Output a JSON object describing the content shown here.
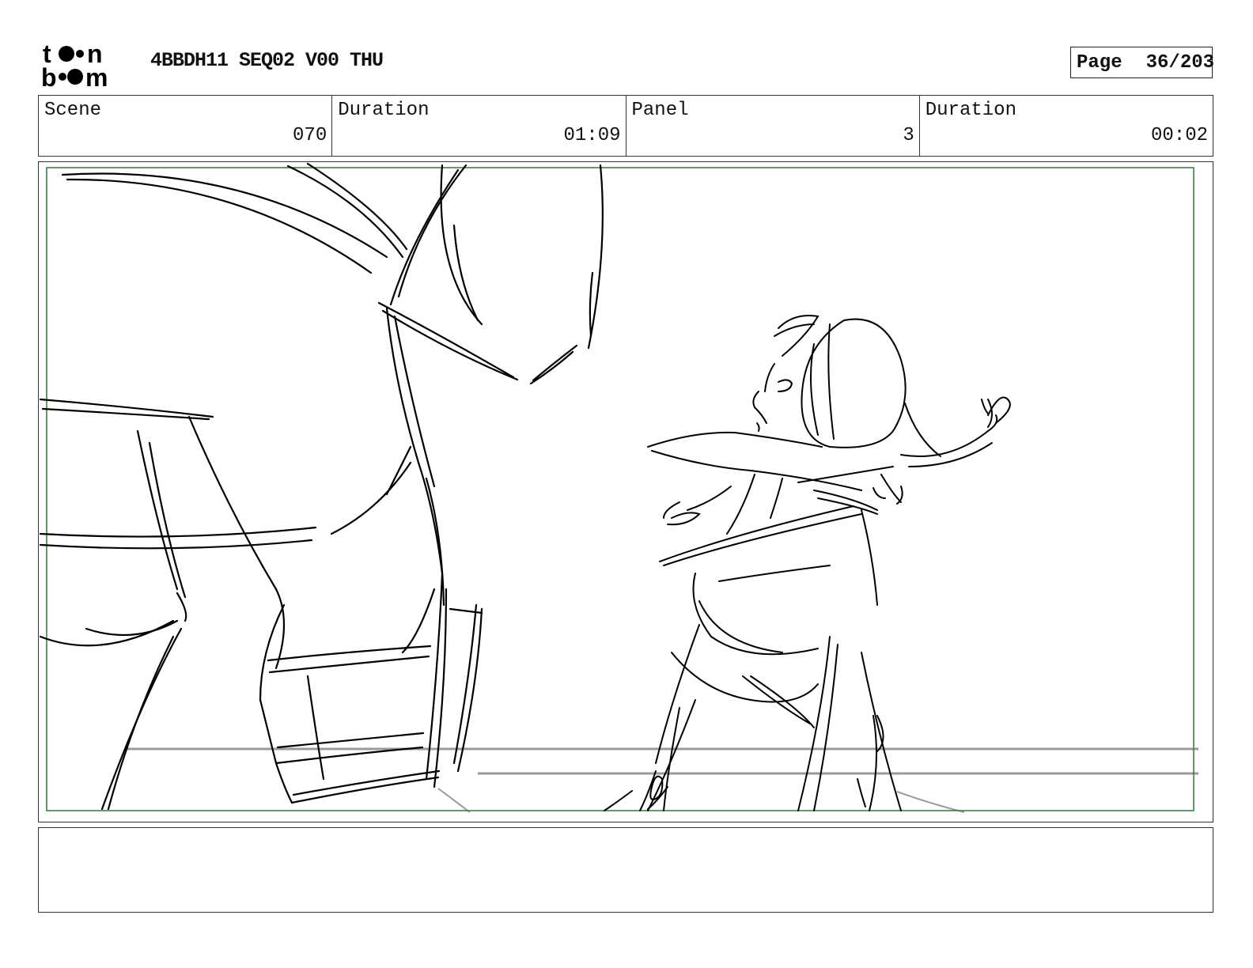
{
  "header": {
    "logo_text": "toon boom",
    "project_title": "4BBDH11 SEQ02 V00 THU",
    "page_label": "Page",
    "page_number": "36/203"
  },
  "info": {
    "scene_label": "Scene",
    "scene_value": "070",
    "scene_duration_label": "Duration",
    "scene_duration_value": "01:09",
    "panel_label": "Panel",
    "panel_value": "3",
    "panel_duration_label": "Duration",
    "panel_duration_value": "00:02"
  },
  "notes": {
    "text": ""
  },
  "colors": {
    "safe_frame": "#2e7d32",
    "sketch": "#000000",
    "ground_line": "#9a9a9a"
  }
}
